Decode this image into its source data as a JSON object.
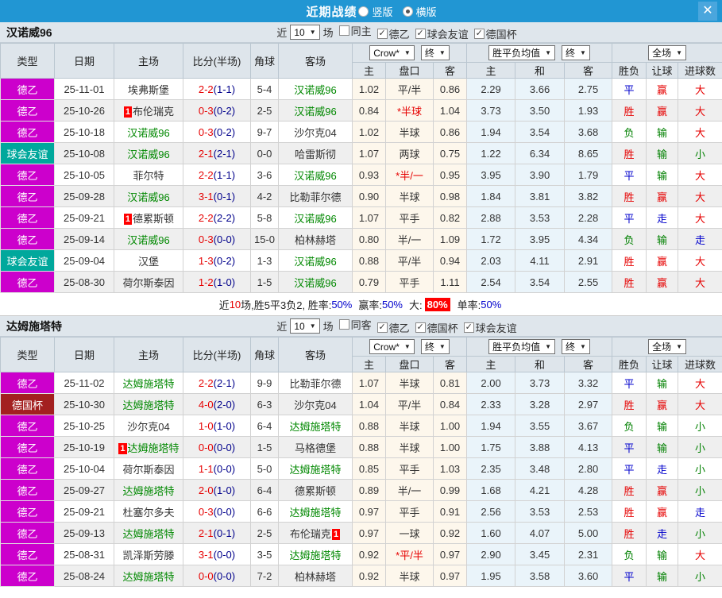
{
  "header": {
    "title": "近期战绩",
    "radio_vertical": "竖版",
    "radio_horizontal": "横版"
  },
  "icons": {
    "dropdown": "▼",
    "check": "✓",
    "close": "✕",
    "badge": "1"
  },
  "filter_labels": {
    "near": "近",
    "count": "10",
    "games": "场"
  },
  "columns": {
    "type": "类型",
    "date": "日期",
    "home": "主场",
    "score": "比分(半场)",
    "corner": "角球",
    "away": "客场",
    "select_crown": "Crow*",
    "select_final": "终",
    "select_avg": "胜平负均值",
    "select_fulltime": "全场",
    "sub_home": "主",
    "sub_handicap": "盘口",
    "sub_away": "客",
    "avg_home": "主",
    "avg_draw": "和",
    "avg_away": "客",
    "wdl": "胜负",
    "handicap_result": "让球",
    "goals": "进球数"
  },
  "type_colors": {
    "德乙": "#cc00cc",
    "球会友谊": "#00a89c",
    "德国杯": "#a32020"
  },
  "teams": [
    {
      "name": "汉诺威96",
      "filters": [
        {
          "label": "同主",
          "checked": false
        },
        {
          "label": "德乙",
          "checked": true
        },
        {
          "label": "球会友谊",
          "checked": true
        },
        {
          "label": "德国杯",
          "checked": true
        }
      ],
      "rows": [
        {
          "type": "德乙",
          "date": "25-11-01",
          "home": "埃弗斯堡",
          "hs": false,
          "hb": false,
          "ft": "2-2",
          "ht": "(1-1)",
          "cor": "5-4",
          "away": "汉诺威96",
          "as": true,
          "ab": false,
          "o1": "1.02",
          "hcp": "平/半",
          "hr": false,
          "o2": "0.86",
          "a1": "2.29",
          "a2": "3.66",
          "a3": "2.75",
          "r1": "平",
          "c1": "blue",
          "r2": "赢",
          "c2": "red",
          "r3": "大",
          "c3": "red"
        },
        {
          "type": "德乙",
          "date": "25-10-26",
          "home": "布伦瑞克",
          "hs": false,
          "hb": true,
          "ft": "0-3",
          "ht": "(0-2)",
          "cor": "2-5",
          "away": "汉诺威96",
          "as": true,
          "ab": false,
          "o1": "0.84",
          "hcp": "*半球",
          "hr": true,
          "o2": "1.04",
          "a1": "3.73",
          "a2": "3.50",
          "a3": "1.93",
          "r1": "胜",
          "c1": "red",
          "r2": "赢",
          "c2": "red",
          "r3": "大",
          "c3": "red"
        },
        {
          "type": "德乙",
          "date": "25-10-18",
          "home": "汉诺威96",
          "hs": true,
          "hb": false,
          "ft": "0-3",
          "ht": "(0-2)",
          "cor": "9-7",
          "away": "沙尔克04",
          "as": false,
          "ab": false,
          "o1": "1.02",
          "hcp": "半球",
          "hr": false,
          "o2": "0.86",
          "a1": "1.94",
          "a2": "3.54",
          "a3": "3.68",
          "r1": "负",
          "c1": "green",
          "r2": "输",
          "c2": "green",
          "r3": "大",
          "c3": "red"
        },
        {
          "type": "球会友谊",
          "date": "25-10-08",
          "home": "汉诺威96",
          "hs": true,
          "hb": false,
          "ft": "2-1",
          "ht": "(2-1)",
          "cor": "0-0",
          "away": "哈雷斯彻",
          "as": false,
          "ab": false,
          "o1": "1.07",
          "hcp": "两球",
          "hr": false,
          "o2": "0.75",
          "a1": "1.22",
          "a2": "6.34",
          "a3": "8.65",
          "r1": "胜",
          "c1": "red",
          "r2": "输",
          "c2": "green",
          "r3": "小",
          "c3": "green"
        },
        {
          "type": "德乙",
          "date": "25-10-05",
          "home": "菲尔特",
          "hs": false,
          "hb": false,
          "ft": "2-2",
          "ht": "(1-1)",
          "cor": "3-6",
          "away": "汉诺威96",
          "as": true,
          "ab": false,
          "o1": "0.93",
          "hcp": "*半/一",
          "hr": true,
          "o2": "0.95",
          "a1": "3.95",
          "a2": "3.90",
          "a3": "1.79",
          "r1": "平",
          "c1": "blue",
          "r2": "输",
          "c2": "green",
          "r3": "大",
          "c3": "red"
        },
        {
          "type": "德乙",
          "date": "25-09-28",
          "home": "汉诺威96",
          "hs": true,
          "hb": false,
          "ft": "3-1",
          "ht": "(0-1)",
          "cor": "4-2",
          "away": "比勒菲尔德",
          "as": false,
          "ab": false,
          "o1": "0.90",
          "hcp": "半球",
          "hr": false,
          "o2": "0.98",
          "a1": "1.84",
          "a2": "3.81",
          "a3": "3.82",
          "r1": "胜",
          "c1": "red",
          "r2": "赢",
          "c2": "red",
          "r3": "大",
          "c3": "red"
        },
        {
          "type": "德乙",
          "date": "25-09-21",
          "home": "德累斯顿",
          "hs": false,
          "hb": true,
          "ft": "2-2",
          "ht": "(2-2)",
          "cor": "5-8",
          "away": "汉诺威96",
          "as": true,
          "ab": false,
          "o1": "1.07",
          "hcp": "平手",
          "hr": false,
          "o2": "0.82",
          "a1": "2.88",
          "a2": "3.53",
          "a3": "2.28",
          "r1": "平",
          "c1": "blue",
          "r2": "走",
          "c2": "blue",
          "r3": "大",
          "c3": "red"
        },
        {
          "type": "德乙",
          "date": "25-09-14",
          "home": "汉诺威96",
          "hs": true,
          "hb": false,
          "ft": "0-3",
          "ht": "(0-0)",
          "cor": "15-0",
          "away": "柏林赫塔",
          "as": false,
          "ab": false,
          "o1": "0.80",
          "hcp": "半/一",
          "hr": false,
          "o2": "1.09",
          "a1": "1.72",
          "a2": "3.95",
          "a3": "4.34",
          "r1": "负",
          "c1": "green",
          "r2": "输",
          "c2": "green",
          "r3": "走",
          "c3": "blue"
        },
        {
          "type": "球会友谊",
          "date": "25-09-04",
          "home": "汉堡",
          "hs": false,
          "hb": false,
          "ft": "1-3",
          "ht": "(0-2)",
          "cor": "1-3",
          "away": "汉诺威96",
          "as": true,
          "ab": false,
          "o1": "0.88",
          "hcp": "平/半",
          "hr": false,
          "o2": "0.94",
          "a1": "2.03",
          "a2": "4.11",
          "a3": "2.91",
          "r1": "胜",
          "c1": "red",
          "r2": "赢",
          "c2": "red",
          "r3": "大",
          "c3": "red"
        },
        {
          "type": "德乙",
          "date": "25-08-30",
          "home": "荷尔斯泰因",
          "hs": false,
          "hb": false,
          "ft": "1-2",
          "ht": "(1-0)",
          "cor": "1-5",
          "away": "汉诺威96",
          "as": true,
          "ab": false,
          "o1": "0.79",
          "hcp": "平手",
          "hr": false,
          "o2": "1.11",
          "a1": "2.54",
          "a2": "3.54",
          "a3": "2.55",
          "r1": "胜",
          "c1": "red",
          "r2": "赢",
          "c2": "red",
          "r3": "大",
          "c3": "red"
        }
      ],
      "summary": {
        "t1": "近",
        "t2": "10",
        "t3": "场,胜5平3负2, 胜率:",
        "t4": "50%",
        "t5": "赢率:",
        "t6": "50%",
        "t7": "大:",
        "t8": "80%",
        "t9": "单率:",
        "t10": "50%"
      }
    },
    {
      "name": "达姆施塔特",
      "filters": [
        {
          "label": "同客",
          "checked": false
        },
        {
          "label": "德乙",
          "checked": true
        },
        {
          "label": "德国杯",
          "checked": true
        },
        {
          "label": "球会友谊",
          "checked": true
        }
      ],
      "rows": [
        {
          "type": "德乙",
          "date": "25-11-02",
          "home": "达姆施塔特",
          "hs": true,
          "hb": false,
          "ft": "2-2",
          "ht": "(2-1)",
          "cor": "9-9",
          "away": "比勒菲尔德",
          "as": false,
          "ab": false,
          "o1": "1.07",
          "hcp": "半球",
          "hr": false,
          "o2": "0.81",
          "a1": "2.00",
          "a2": "3.73",
          "a3": "3.32",
          "r1": "平",
          "c1": "blue",
          "r2": "输",
          "c2": "green",
          "r3": "大",
          "c3": "red"
        },
        {
          "type": "德国杯",
          "date": "25-10-30",
          "home": "达姆施塔特",
          "hs": true,
          "hb": false,
          "ft": "4-0",
          "ht": "(2-0)",
          "cor": "6-3",
          "away": "沙尔克04",
          "as": false,
          "ab": false,
          "o1": "1.04",
          "hcp": "平/半",
          "hr": false,
          "o2": "0.84",
          "a1": "2.33",
          "a2": "3.28",
          "a3": "2.97",
          "r1": "胜",
          "c1": "red",
          "r2": "赢",
          "c2": "red",
          "r3": "大",
          "c3": "red"
        },
        {
          "type": "德乙",
          "date": "25-10-25",
          "home": "沙尔克04",
          "hs": false,
          "hb": false,
          "ft": "1-0",
          "ht": "(1-0)",
          "cor": "6-4",
          "away": "达姆施塔特",
          "as": true,
          "ab": false,
          "o1": "0.88",
          "hcp": "半球",
          "hr": false,
          "o2": "1.00",
          "a1": "1.94",
          "a2": "3.55",
          "a3": "3.67",
          "r1": "负",
          "c1": "green",
          "r2": "输",
          "c2": "green",
          "r3": "小",
          "c3": "green"
        },
        {
          "type": "德乙",
          "date": "25-10-19",
          "home": "达姆施塔特",
          "hs": true,
          "hb": true,
          "ft": "0-0",
          "ht": "(0-0)",
          "cor": "1-5",
          "away": "马格德堡",
          "as": false,
          "ab": false,
          "o1": "0.88",
          "hcp": "半球",
          "hr": false,
          "o2": "1.00",
          "a1": "1.75",
          "a2": "3.88",
          "a3": "4.13",
          "r1": "平",
          "c1": "blue",
          "r2": "输",
          "c2": "green",
          "r3": "小",
          "c3": "green"
        },
        {
          "type": "德乙",
          "date": "25-10-04",
          "home": "荷尔斯泰因",
          "hs": false,
          "hb": false,
          "ft": "1-1",
          "ht": "(0-0)",
          "cor": "5-0",
          "away": "达姆施塔特",
          "as": true,
          "ab": false,
          "o1": "0.85",
          "hcp": "平手",
          "hr": false,
          "o2": "1.03",
          "a1": "2.35",
          "a2": "3.48",
          "a3": "2.80",
          "r1": "平",
          "c1": "blue",
          "r2": "走",
          "c2": "blue",
          "r3": "小",
          "c3": "green"
        },
        {
          "type": "德乙",
          "date": "25-09-27",
          "home": "达姆施塔特",
          "hs": true,
          "hb": false,
          "ft": "2-0",
          "ht": "(1-0)",
          "cor": "6-4",
          "away": "德累斯顿",
          "as": false,
          "ab": false,
          "o1": "0.89",
          "hcp": "半/一",
          "hr": false,
          "o2": "0.99",
          "a1": "1.68",
          "a2": "4.21",
          "a3": "4.28",
          "r1": "胜",
          "c1": "red",
          "r2": "赢",
          "c2": "red",
          "r3": "小",
          "c3": "green"
        },
        {
          "type": "德乙",
          "date": "25-09-21",
          "home": "杜塞尔多夫",
          "hs": false,
          "hb": false,
          "ft": "0-3",
          "ht": "(0-0)",
          "cor": "6-6",
          "away": "达姆施塔特",
          "as": true,
          "ab": false,
          "o1": "0.97",
          "hcp": "平手",
          "hr": false,
          "o2": "0.91",
          "a1": "2.56",
          "a2": "3.53",
          "a3": "2.53",
          "r1": "胜",
          "c1": "red",
          "r2": "赢",
          "c2": "red",
          "r3": "走",
          "c3": "blue"
        },
        {
          "type": "德乙",
          "date": "25-09-13",
          "home": "达姆施塔特",
          "hs": true,
          "hb": false,
          "ft": "2-1",
          "ht": "(0-1)",
          "cor": "2-5",
          "away": "布伦瑞克",
          "as": false,
          "ab": true,
          "o1": "0.97",
          "hcp": "一球",
          "hr": false,
          "o2": "0.92",
          "a1": "1.60",
          "a2": "4.07",
          "a3": "5.00",
          "r1": "胜",
          "c1": "red",
          "r2": "走",
          "c2": "blue",
          "r3": "小",
          "c3": "green"
        },
        {
          "type": "德乙",
          "date": "25-08-31",
          "home": "凯泽斯劳滕",
          "hs": false,
          "hb": false,
          "ft": "3-1",
          "ht": "(0-0)",
          "cor": "3-5",
          "away": "达姆施塔特",
          "as": true,
          "ab": false,
          "o1": "0.92",
          "hcp": "*平/半",
          "hr": true,
          "o2": "0.97",
          "a1": "2.90",
          "a2": "3.45",
          "a3": "2.31",
          "r1": "负",
          "c1": "green",
          "r2": "输",
          "c2": "green",
          "r3": "大",
          "c3": "red"
        },
        {
          "type": "德乙",
          "date": "25-08-24",
          "home": "达姆施塔特",
          "hs": true,
          "hb": false,
          "ft": "0-0",
          "ht": "(0-0)",
          "cor": "7-2",
          "away": "柏林赫塔",
          "as": false,
          "ab": false,
          "o1": "0.92",
          "hcp": "半球",
          "hr": false,
          "o2": "0.97",
          "a1": "1.95",
          "a2": "3.58",
          "a3": "3.60",
          "r1": "平",
          "c1": "blue",
          "r2": "输",
          "c2": "green",
          "r3": "小",
          "c3": "green"
        }
      ],
      "summary": null
    }
  ]
}
